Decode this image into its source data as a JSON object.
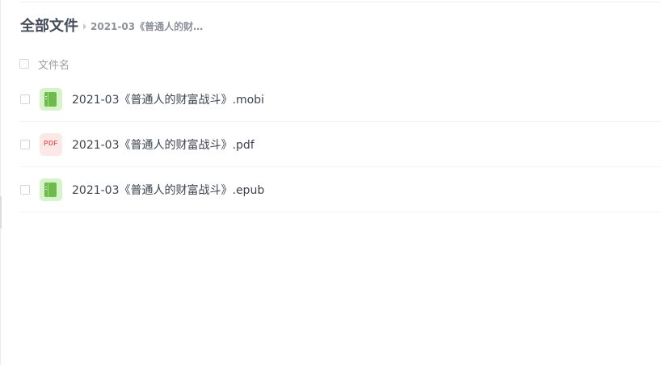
{
  "breadcrumb": {
    "root": "全部文件",
    "current": "2021-03《普通人的财…"
  },
  "list_header": {
    "name_column": "文件名"
  },
  "files": [
    {
      "name": "2021-03《普通人的财富战斗》.mobi",
      "icon": "ebook-icon"
    },
    {
      "name": "2021-03《普通人的财富战斗》.pdf",
      "icon": "pdf-icon",
      "icon_text": "PDF"
    },
    {
      "name": "2021-03《普通人的财富战斗》.epub",
      "icon": "ebook-icon"
    }
  ],
  "colors": {
    "ebook_icon": "#6dbb4b",
    "ebook_icon_bg": "#d6f3c9",
    "pdf_icon": "#ef5b5b",
    "pdf_icon_bg": "#fde8e8"
  }
}
